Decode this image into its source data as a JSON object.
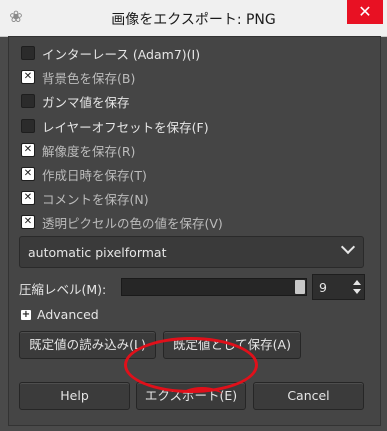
{
  "window": {
    "title": "画像をエクスポート: PNG",
    "app_icon": "gimp-wilber-icon",
    "close_glyph": "✕"
  },
  "options": [
    {
      "label": "インターレース (Adam7)(I)",
      "checked": false
    },
    {
      "label": "背景色を保存(B)",
      "checked": true
    },
    {
      "label": "ガンマ値を保存",
      "checked": false
    },
    {
      "label": "レイヤーオフセットを保存(F)",
      "checked": false
    },
    {
      "label": "解像度を保存(R)",
      "checked": true
    },
    {
      "label": "作成日時を保存(T)",
      "checked": true
    },
    {
      "label": "コメントを保存(N)",
      "checked": true
    },
    {
      "label": "透明ピクセルの色の値を保存(V)",
      "checked": true
    }
  ],
  "pixelformat": {
    "selected": "automatic pixelformat"
  },
  "compression": {
    "label": "圧縮レベル(M):",
    "value": "9",
    "level_fraction": 1.0
  },
  "advanced": {
    "label": "Advanced"
  },
  "defaults": {
    "load_label": "既定値の読み込み(L)",
    "save_label": "既定値として保存(A)"
  },
  "actions": {
    "help_label": "Help",
    "export_label": "エクスポート(E)",
    "cancel_label": "Cancel"
  },
  "colors": {
    "close_bg": "#e81123",
    "annotation_circle": "#e0101a"
  }
}
